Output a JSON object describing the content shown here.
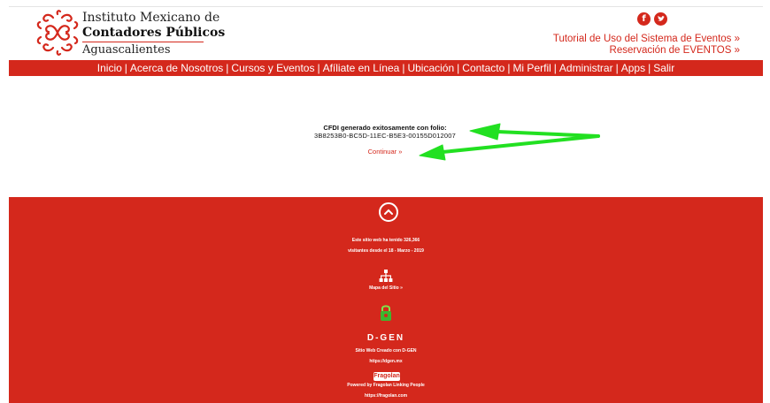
{
  "brand": {
    "line1": "Instituto Mexicano de",
    "line2": "Contadores Públicos",
    "line3": "Aguascalientes"
  },
  "social": {
    "facebook_icon": "facebook-icon",
    "twitter_icon": "twitter-icon",
    "facebook_glyph": "f",
    "twitter_glyph": "t"
  },
  "toplinks": {
    "tutorial": "Tutorial de Uso del Sistema de Eventos »",
    "reservacion": "Reservación de EVENTOS »"
  },
  "nav": {
    "items": [
      "Inicio",
      "Acerca de Nosotros",
      "Cursos y Eventos",
      "Afíliate en Línea",
      "Ubicación",
      "Contacto",
      "Mi Perfil",
      "Administrar",
      "Apps",
      "Salir"
    ],
    "separator": "|"
  },
  "message": {
    "title": "CFDI generado exitosamente con folio:",
    "folio": "3B8253B0-BC5D-11EC-B5E3-00155D012007",
    "continue": "Continuar »"
  },
  "footer": {
    "visits_line1": "Este sitio web ha tenido 326,366",
    "visits_line2": "visitantes desde el 18 - Marzo - 2019",
    "sitemap": "Mapa del Sitio »",
    "dgen_logo": "D-GEN",
    "dgen_line1": "Sitio Web Creado con D-GEN",
    "dgen_line2": "https://dgen.mx",
    "fragolan_logo": "Fragolan",
    "fragolan_line1": "Powered by Fragolan Linking People",
    "fragolan_line2": "https://fragolan.com"
  },
  "colors": {
    "brand_red": "#d4281c",
    "annotation_green": "#22e021"
  }
}
